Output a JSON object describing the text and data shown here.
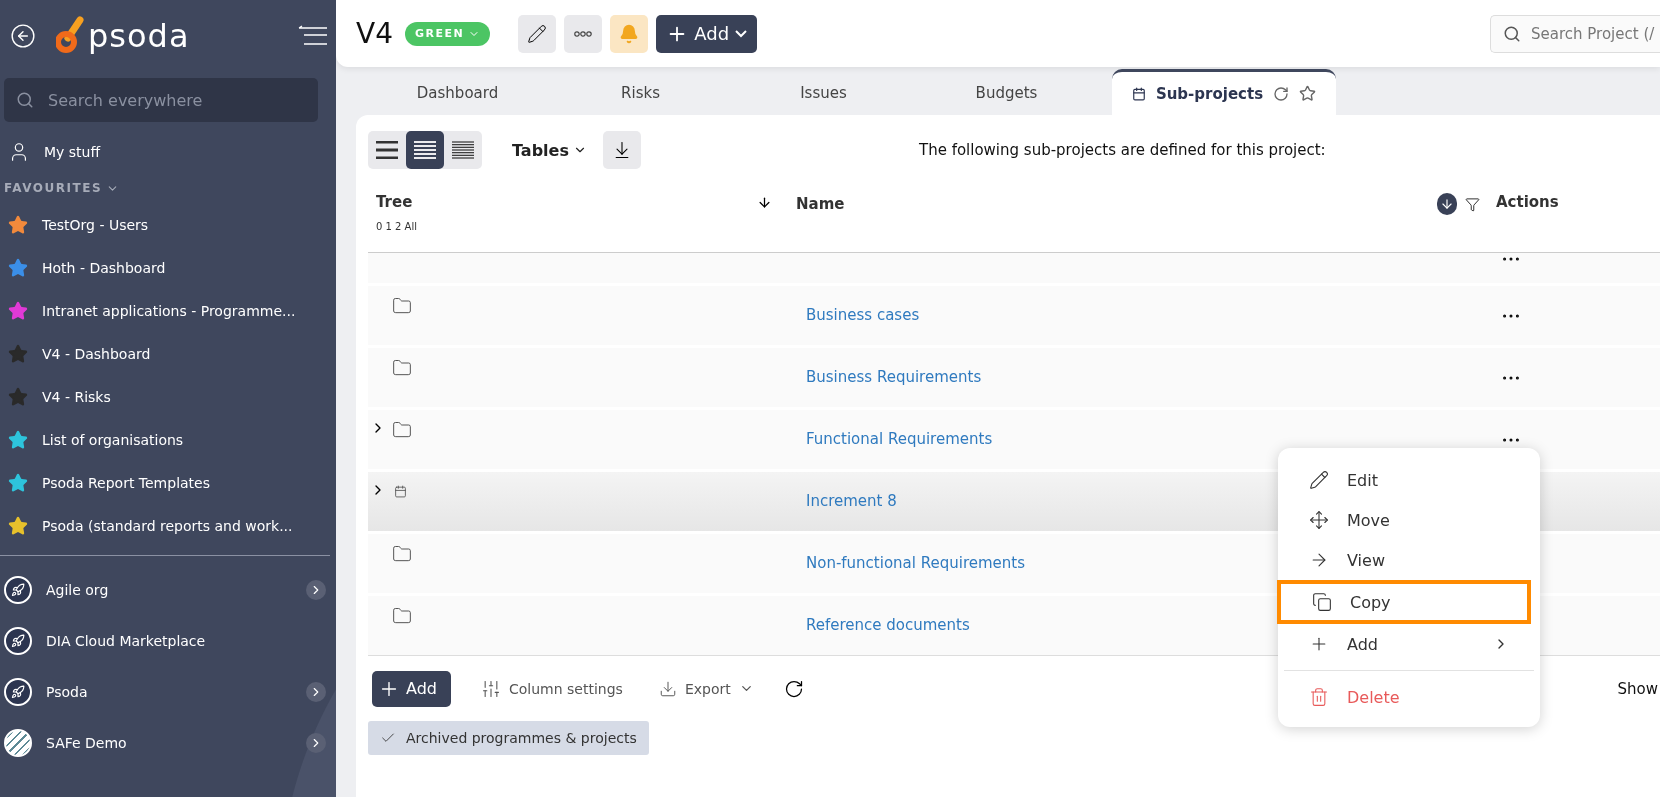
{
  "sidebar": {
    "logo": "psoda",
    "search": {
      "placeholder": "Search everywhere"
    },
    "my_stuff": "My stuff",
    "favourites_heading": "FAVOURITES",
    "favourites": [
      {
        "label": "TestOrg - Users",
        "color": "#f28a3c"
      },
      {
        "label": "Hoth - Dashboard",
        "color": "#3b8fe8"
      },
      {
        "label": "Intranet applications - Programme...",
        "color": "#e03ad6"
      },
      {
        "label": "V4 - Dashboard",
        "color": "#2a2a2a"
      },
      {
        "label": "V4 - Risks",
        "color": "#2a2a2a"
      },
      {
        "label": "List of organisations",
        "color": "#2ec4dc"
      },
      {
        "label": "Psoda Report Templates",
        "color": "#2ec4dc"
      },
      {
        "label": "Psoda (standard reports and work...",
        "color": "#e7c12c"
      }
    ],
    "organisations": [
      {
        "label": "Agile org",
        "kind": "rocket",
        "has_children": true
      },
      {
        "label": "DIA Cloud Marketplace",
        "kind": "rocket",
        "has_children": false
      },
      {
        "label": "Psoda",
        "kind": "rocket",
        "has_children": true
      },
      {
        "label": "SAFe Demo",
        "kind": "stripes",
        "has_children": true
      }
    ]
  },
  "header": {
    "title": "V4",
    "status": "GREEN",
    "add": "Add",
    "search": {
      "placeholder": "Search Project (/"
    }
  },
  "tabs": [
    {
      "label": "Dashboard",
      "selected": false
    },
    {
      "label": "Risks",
      "selected": false
    },
    {
      "label": "Issues",
      "selected": false
    },
    {
      "label": "Budgets",
      "selected": false
    },
    {
      "label": "Sub-projects",
      "selected": true
    }
  ],
  "toolbar": {
    "view_modes": [
      {
        "kind": "large",
        "selected": false
      },
      {
        "kind": "medium",
        "selected": true
      },
      {
        "kind": "small",
        "selected": false
      }
    ],
    "tables": "Tables",
    "description": "The following sub-projects are defined for this project:"
  },
  "table": {
    "columns": [
      {
        "label": "Tree",
        "levels": "0 1 2 All"
      },
      {
        "label": "Name"
      },
      {
        "label": "Actions"
      }
    ],
    "rows": [
      {
        "name": "Business cases",
        "kind": "folder",
        "expandable": false,
        "highlighted": false
      },
      {
        "name": "Business Requirements",
        "kind": "folder",
        "expandable": false,
        "highlighted": false
      },
      {
        "name": "Functional Requirements",
        "kind": "folder",
        "expandable": true,
        "highlighted": false
      },
      {
        "name": "Increment 8",
        "kind": "project",
        "expandable": true,
        "highlighted": true
      },
      {
        "name": "Non-functional Requirements",
        "kind": "folder",
        "expandable": false,
        "highlighted": false
      },
      {
        "name": "Reference documents",
        "kind": "folder",
        "expandable": false,
        "highlighted": false
      }
    ]
  },
  "footer": {
    "add": "Add",
    "column_settings": "Column settings",
    "export": "Export",
    "archived": {
      "label": "Archived programmes & projects",
      "checked": true
    },
    "show": "Show"
  },
  "context_menu": {
    "items": [
      {
        "label": "Edit",
        "kind": "edit",
        "highlighted": false
      },
      {
        "label": "Move",
        "kind": "move",
        "highlighted": false
      },
      {
        "label": "View",
        "kind": "view",
        "highlighted": false
      },
      {
        "label": "Copy",
        "kind": "copy",
        "highlighted": true
      },
      {
        "label": "Add",
        "kind": "add",
        "highlighted": false
      },
      {
        "label": "Delete",
        "kind": "delete",
        "highlighted": false
      }
    ]
  }
}
